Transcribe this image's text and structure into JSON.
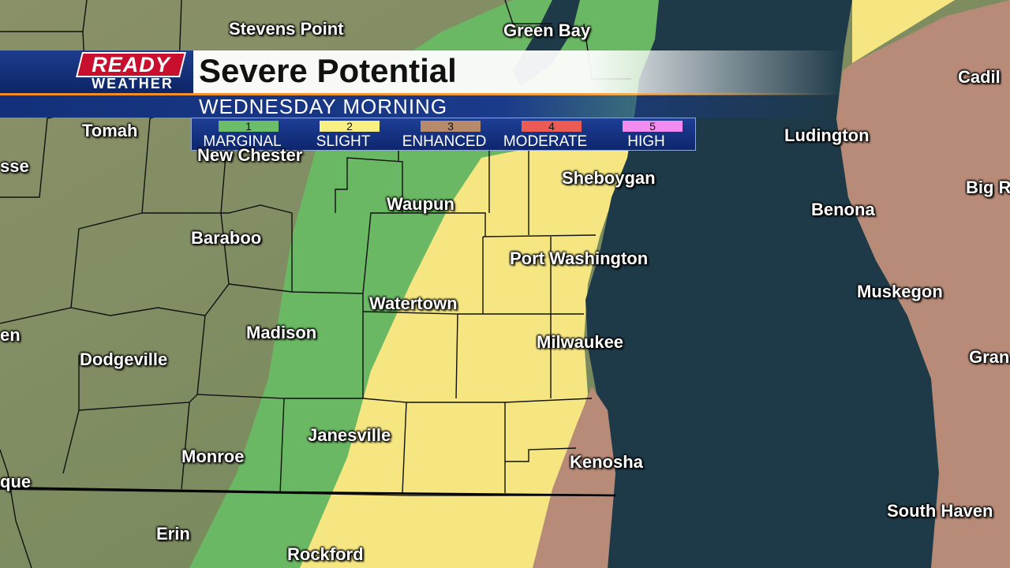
{
  "logo": {
    "line1": "READY",
    "line2": "WEATHER"
  },
  "title": "Severe Potential",
  "subtitle": "WEDNESDAY MORNING",
  "legend": [
    {
      "level": "1",
      "label": "MARGINAL",
      "color": "#6cbd6a"
    },
    {
      "level": "2",
      "label": "SLIGHT",
      "color": "#f9ee82"
    },
    {
      "level": "3",
      "label": "ENHANCED",
      "color": "#b88a6c"
    },
    {
      "level": "4",
      "label": "MODERATE",
      "color": "#ec5a54"
    },
    {
      "level": "5",
      "label": "HIGH",
      "color": "#f38cf0"
    }
  ],
  "colors": {
    "lake": "#1e3a48",
    "land": "#7c8a62",
    "marginal": "#6ab764",
    "slight": "#f5e682",
    "enhanced": "#b88a78"
  },
  "cities": {
    "stevens_point": "Stevens Point",
    "green_bay": "Green Bay",
    "cadillac": "Cadil",
    "tomah": "Tomah",
    "new_chester": "New Chester",
    "crosse": "sse",
    "ludington": "Ludington",
    "sheboygan": "Sheboygan",
    "big_rapids": "Big R",
    "waupun": "Waupun",
    "benona": "Benona",
    "baraboo": "Baraboo",
    "port_washington": "Port Washington",
    "muskegon": "Muskegon",
    "watertown": "Watertown",
    "madison": "Madison",
    "en": "en",
    "milwaukee": "Milwaukee",
    "dodgeville": "Dodgeville",
    "grand": "Gran",
    "janesville": "Janesville",
    "monroe": "Monroe",
    "kenosha": "Kenosha",
    "dubuque": "que",
    "south_haven": "South Haven",
    "erin": "Erin",
    "rockford": "Rockford"
  }
}
